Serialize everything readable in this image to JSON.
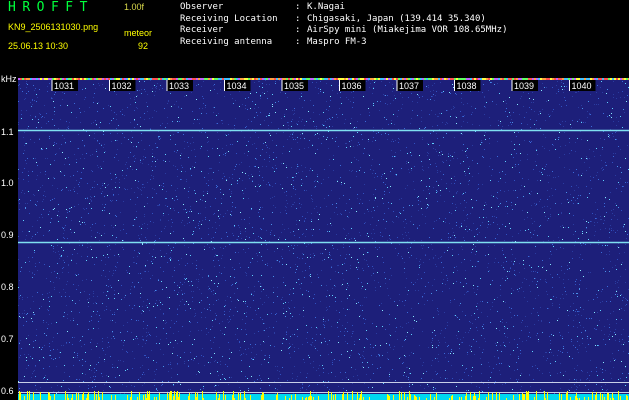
{
  "header": {
    "logo": "HROFFT",
    "version": "1.00f",
    "filename": "KN9_2506131030.png",
    "meteor_label": "meteor",
    "datetime": "25.06.13 10:30",
    "meteor_count": "92",
    "info": [
      {
        "key": "Observer",
        "sep": ":",
        "value": "K.Nagai"
      },
      {
        "key": "Receiving Location",
        "sep": ":",
        "value": "Chigasaki, Japan (139.414 35.340)"
      },
      {
        "key": "Receiver",
        "sep": ":",
        "value": "AirSpy mini (Miakejima VOR 108.65MHz)"
      },
      {
        "key": "Receiving antenna",
        "sep": ":",
        "value": "Maspro FM-3"
      }
    ]
  },
  "chart_data": {
    "type": "heatmap",
    "ylabel": "kHz",
    "yticks": [
      "1.1",
      "1.0",
      "0.9",
      "0.8",
      "0.7",
      "0.6"
    ],
    "ytick_values": [
      1.1,
      1.0,
      0.9,
      0.8,
      0.7,
      0.6
    ],
    "ylim": [
      0.585,
      1.205
    ],
    "x_minute_labels": [
      "1031",
      "1032",
      "1033",
      "1034",
      "1035",
      "1036",
      "1037",
      "1038",
      "1039",
      "1040"
    ],
    "xlim_minutes": [
      0,
      10
    ],
    "horizontal_lines_khz": [
      1.105,
      0.889,
      0.619,
      0.601
    ],
    "colors": {
      "background": "#1d1f7a",
      "noise_high": "#5fd0ff",
      "line": "#7fe0f0",
      "label": "#ffffff",
      "logo": "#00ff3c",
      "yellow": "#ffff00"
    }
  }
}
